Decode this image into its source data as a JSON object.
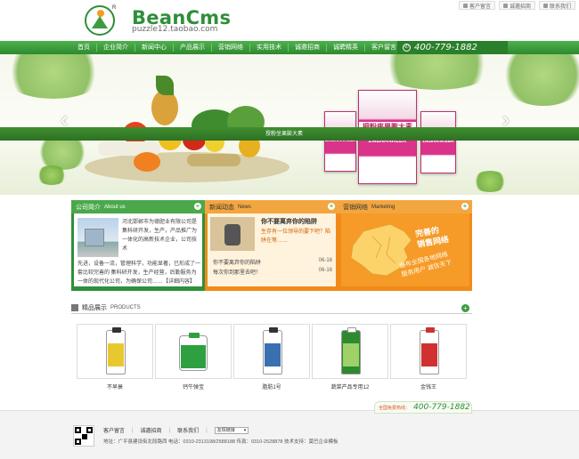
{
  "header": {
    "brand": "BeanCms",
    "subtitle": "puzzle12.taobao.com",
    "logo_mark": "R",
    "top_links": [
      {
        "label": "客户留言",
        "icon": "message-icon"
      },
      {
        "label": "诚邀招商",
        "icon": "mail-icon"
      },
      {
        "label": "联系我们",
        "icon": "contact-icon"
      }
    ]
  },
  "nav": {
    "items": [
      "首页",
      "企业简介",
      "新闻中心",
      "产品展示",
      "营销网络",
      "实用技术",
      "诚邀招商",
      "诚聘精英",
      "客户留言"
    ],
    "phone": "400-779-1882"
  },
  "banner": {
    "packages": [
      {
        "brand": "ZMBNANKEER",
        "title": "授粉座果膨大素"
      },
      {
        "brand": "ZMBNANKEER",
        "title": "授粉座果膨大素"
      },
      {
        "brand": "ZMBNANKEER",
        "title": "授粉座果膨大素"
      }
    ],
    "caption": "授粉坐果膨大素",
    "prev_icon": "‹",
    "next_icon": "›"
  },
  "about": {
    "title": "公司简介",
    "title_en": "About us",
    "text_top": "河北邯郸市为德肥业有限公司是集科研开发，生产，产品推广为一体化的高新技术企业，公司技术",
    "text_bottom": "先进，设备一流，管理科学，功能显著，已形成了一套比较完善的 集科研开发，生产经营，后勤服务为一体的现代化公司，为确保公司……【详细内容】",
    "more": "+"
  },
  "news": {
    "title": "新闻动态",
    "title_en": "News",
    "headline": "你不要离弃你的陷阱",
    "desc": "生存有一位领导的要下吧？陷阱在等……",
    "items": [
      {
        "title": "你不要离弃你的陷阱",
        "date": "06-16"
      },
      {
        "title": "每次你到那里去吧！",
        "date": "06-16"
      }
    ],
    "more": "+"
  },
  "marketing": {
    "title": "营销网络",
    "title_en": "Marketing",
    "slogan": "完善的\n销售网络",
    "sub": "遍布全国各地网络\n服务用户 诚信天下",
    "more": "+"
  },
  "products": {
    "title": "精品展示",
    "title_en": "PRODUCTS",
    "more": "+",
    "items": [
      {
        "name": "不早衰",
        "label_color": "#e8c830"
      },
      {
        "name": "钙牛弹宝",
        "label_color": "#2fa040"
      },
      {
        "name": "脂肪1号",
        "label_color": "#3a6fb0"
      },
      {
        "name": "蔬菜产品专用12",
        "label_color": "#2e8a2e"
      },
      {
        "name": "金钱王",
        "label_color": "#d03030"
      }
    ]
  },
  "footer": {
    "hot_label": "全国免费热线：",
    "hot_phone": "400-779-1882",
    "links": [
      "客户留言",
      "诚邀招商",
      "联系我们"
    ],
    "select_value": "友情链接",
    "address": "地址：广平县建设街北段路西  电话：0310-2313198/2588188  传真：0310-2528878  技术支持：莫巴企业模板"
  },
  "colors": {
    "green": "#2f8f3a",
    "orange": "#f08b1a",
    "pink": "#d9338a"
  }
}
